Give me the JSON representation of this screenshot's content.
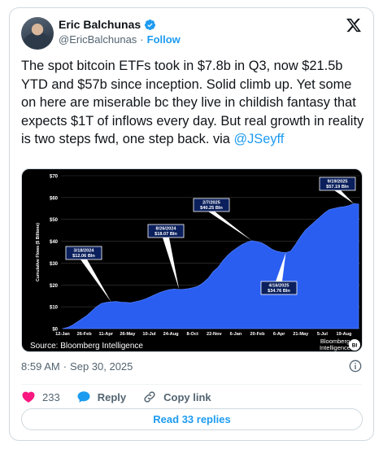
{
  "author": {
    "display_name": "Eric Balchunas",
    "handle": "@EricBalchunas",
    "separator": "·",
    "follow_label": "Follow"
  },
  "tweet": {
    "text_main": "The spot bitcoin ETFs took in $7.8b in Q3, now $21.5b YTD and $57b since inception. Solid climb up. Yet some on here are miserable bc they live in childish fantasy that expects $1T of inflows every day. But real growth in reality is two steps fwd, one step back. via ",
    "mention": "@JSeyff",
    "timestamp_time": "8:59 AM",
    "timestamp_sep": "·",
    "timestamp_date": "Sep 30, 2025"
  },
  "actions": {
    "like_count": "233",
    "reply_label": "Reply",
    "copy_link_label": "Copy link",
    "read_replies_label": "Read 33 replies"
  },
  "colors": {
    "brand_blue": "#1d9bf0",
    "like_red": "#f91880",
    "chart_fill": "#2a5ef0",
    "chart_bg": "#000000"
  },
  "icons": [
    "verified-badge-icon",
    "x-logo-icon",
    "info-icon",
    "heart-icon",
    "reply-bubble-icon",
    "link-icon"
  ],
  "chart_data": {
    "type": "area",
    "title": "",
    "ylabel": "Cumulative Flows ($ Billions)",
    "xlabel": "",
    "ylim": [
      0,
      70
    ],
    "yticks": [
      "$0",
      "$10",
      "$20",
      "$30",
      "$40",
      "$50",
      "$60",
      "$70"
    ],
    "ytick_values": [
      0,
      10,
      20,
      30,
      40,
      50,
      60,
      70
    ],
    "xticks": [
      "12-Jan",
      "26-Feb",
      "11-Apr",
      "26-May",
      "10-Jul",
      "24-Aug",
      "8-Oct",
      "22-Nov",
      "6-Jan",
      "20-Feb",
      "6-Apr",
      "21-May",
      "5-Jul",
      "19-Aug"
    ],
    "series": [
      {
        "values": [
          0,
          0.5,
          1.5,
          3,
          4.5,
          6,
          8,
          10,
          11.5,
          12,
          12.2,
          12.4,
          12.1,
          12.0,
          11.8,
          12.3,
          12.8,
          13.5,
          14.5,
          15.5,
          16.5,
          17.2,
          17.8,
          18.1,
          17.9,
          18.0,
          18.3,
          18.8,
          19.5,
          21,
          23,
          26,
          28,
          31,
          33.5,
          35.5,
          37,
          38.5,
          39.5,
          40.25,
          39.8,
          39.3,
          38.0,
          36.5,
          35.5,
          35.0,
          34.76,
          35.5,
          38.5,
          42,
          45,
          47,
          49,
          51,
          53,
          54.5,
          55.0,
          55.5,
          55.8,
          56.3,
          57.19,
          57.0
        ]
      }
    ],
    "annotations": [
      {
        "date": "3/18/2024",
        "value": "$12.06 Bln"
      },
      {
        "date": "8/26/2024",
        "value": "$18.07 Bln"
      },
      {
        "date": "2/7/2025",
        "value": "$40.25 Bln"
      },
      {
        "date": "4/16/2025",
        "value": "$34.76 Bln"
      },
      {
        "date": "9/19/2025",
        "value": "$57.19 Bln"
      }
    ],
    "source": "Source: Bloomberg Intelligence",
    "brand": [
      "Bloomberg",
      "Intelligence"
    ],
    "brand_badge": "BI",
    "grid": true
  }
}
